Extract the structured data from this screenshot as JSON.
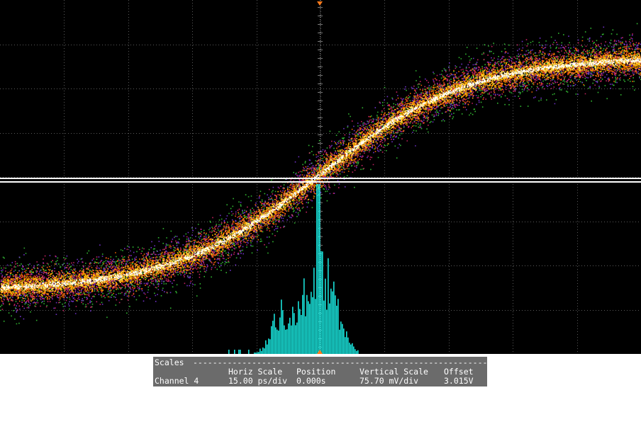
{
  "display": {
    "background_color": "#000000",
    "grid_color": "#5a5a5a",
    "horizontal_divisions": 10,
    "vertical_divisions": 8,
    "trace_colors": [
      "#39d43a",
      "#7a36d8",
      "#d8256a",
      "#ff6a00",
      "#ffb000",
      "#ffe25a",
      "#ffffff"
    ],
    "histogram_color": "#19e0d8",
    "marker_color": "#ff7a1a",
    "divider_color": "#ffffff"
  },
  "scales": {
    "title": "Scales",
    "header_horiz": "Horiz Scale",
    "header_position": "Position",
    "header_vertical": "Vertical Scale",
    "header_offset": "Offset",
    "channel": "Channel 4",
    "horiz_scale": "15.00 ps/div",
    "position": "0.000s",
    "vertical_scale": "75.70 mV/div",
    "offset": "3.015V"
  }
}
